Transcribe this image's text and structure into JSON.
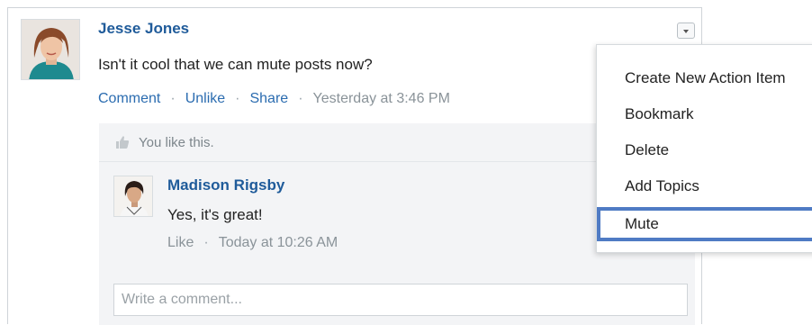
{
  "post": {
    "author": "Jesse Jones",
    "text": "Isn't it cool that we can mute posts now?",
    "actions": {
      "comment": "Comment",
      "unlike": "Unlike",
      "share": "Share",
      "separator": "·"
    },
    "timestamp": "Yesterday at 3:46 PM"
  },
  "likes": {
    "text": "You like this."
  },
  "reply": {
    "author": "Madison Rigsby",
    "text": "Yes, it's great!",
    "like": "Like",
    "separator": "·",
    "timestamp": "Today at 10:26 AM"
  },
  "comment_box": {
    "placeholder": "Write a comment..."
  },
  "menu": {
    "items": [
      "Create New Action Item",
      "Bookmark",
      "Delete",
      "Add Topics",
      "Mute"
    ],
    "highlighted": "Mute"
  },
  "colors": {
    "link": "#2b6cb0",
    "name": "#1f5b9a",
    "highlight_border": "#4f7bc4"
  }
}
